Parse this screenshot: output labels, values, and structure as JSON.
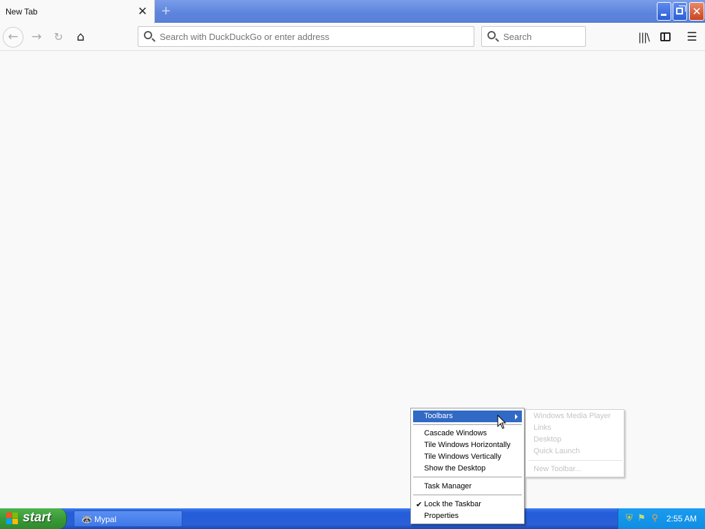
{
  "browser": {
    "tab_title": "New Tab",
    "url_placeholder": "Search with DuckDuckGo or enter address",
    "search_placeholder": "Search"
  },
  "taskbar": {
    "start_label": "start",
    "task_label": "Mypal",
    "clock": "2:55 AM"
  },
  "context_menu": {
    "toolbars": "Toolbars",
    "cascade": "Cascade Windows",
    "tile_h": "Tile Windows Horizontally",
    "tile_v": "Tile Windows Vertically",
    "show_desktop": "Show the Desktop",
    "task_manager": "Task Manager",
    "lock_taskbar": "Lock the Taskbar",
    "properties": "Properties"
  },
  "toolbars_submenu": {
    "wmp": "Windows Media Player",
    "links": "Links",
    "desktop": "Desktop",
    "quick_launch": "Quick Launch",
    "new_toolbar": "New Toolbar..."
  },
  "colors": {
    "menu_highlight": "#316ac5",
    "taskbar_blue": "#245edb",
    "start_green": "#3a9a38"
  }
}
